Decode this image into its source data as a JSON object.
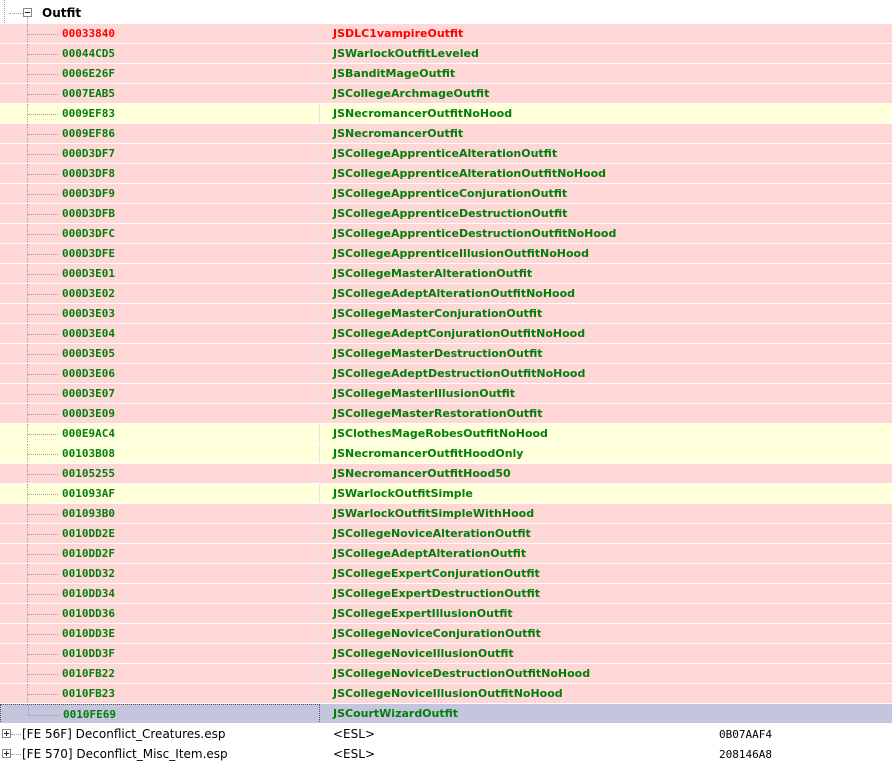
{
  "group": {
    "label": "Outfit",
    "expanded": true
  },
  "records": [
    {
      "formid": "00033840",
      "editor_id": "JSDLC1vampireOutfit",
      "style": "red",
      "text_color": "red"
    },
    {
      "formid": "00044CD5",
      "editor_id": "JSWarlockOutfitLeveled",
      "style": "red",
      "text_color": "green"
    },
    {
      "formid": "0006E26F",
      "editor_id": "JSBanditMageOutfit",
      "style": "red",
      "text_color": "green"
    },
    {
      "formid": "0007EAB5",
      "editor_id": "JSCollegeArchmageOutfit",
      "style": "red",
      "text_color": "green"
    },
    {
      "formid": "0009EF83",
      "editor_id": "JSNecromancerOutfitNoHood",
      "style": "yellow",
      "text_color": "green"
    },
    {
      "formid": "0009EF86",
      "editor_id": "JSNecromancerOutfit",
      "style": "red",
      "text_color": "green"
    },
    {
      "formid": "000D3DF7",
      "editor_id": "JSCollegeApprenticeAlterationOutfit",
      "style": "red",
      "text_color": "green"
    },
    {
      "formid": "000D3DF8",
      "editor_id": "JSCollegeApprenticeAlterationOutfitNoHood",
      "style": "red",
      "text_color": "green"
    },
    {
      "formid": "000D3DF9",
      "editor_id": "JSCollegeApprenticeConjurationOutfit",
      "style": "red",
      "text_color": "green"
    },
    {
      "formid": "000D3DFB",
      "editor_id": "JSCollegeApprenticeDestructionOutfit",
      "style": "red",
      "text_color": "green"
    },
    {
      "formid": "000D3DFC",
      "editor_id": "JSCollegeApprenticeDestructionOutfitNoHood",
      "style": "red",
      "text_color": "green"
    },
    {
      "formid": "000D3DFE",
      "editor_id": "JSCollegeApprenticeIllusionOutfitNoHood",
      "style": "red",
      "text_color": "green"
    },
    {
      "formid": "000D3E01",
      "editor_id": "JSCollegeMasterAlterationOutfit",
      "style": "red",
      "text_color": "green"
    },
    {
      "formid": "000D3E02",
      "editor_id": "JSCollegeAdeptAlterationOutfitNoHood",
      "style": "red",
      "text_color": "green"
    },
    {
      "formid": "000D3E03",
      "editor_id": "JSCollegeMasterConjurationOutfit",
      "style": "red",
      "text_color": "green"
    },
    {
      "formid": "000D3E04",
      "editor_id": "JSCollegeAdeptConjurationOutfitNoHood",
      "style": "red",
      "text_color": "green"
    },
    {
      "formid": "000D3E05",
      "editor_id": "JSCollegeMasterDestructionOutfit",
      "style": "red",
      "text_color": "green"
    },
    {
      "formid": "000D3E06",
      "editor_id": "JSCollegeAdeptDestructionOutfitNoHood",
      "style": "red",
      "text_color": "green"
    },
    {
      "formid": "000D3E07",
      "editor_id": "JSCollegeMasterIllusionOutfit",
      "style": "red",
      "text_color": "green"
    },
    {
      "formid": "000D3E09",
      "editor_id": "JSCollegeMasterRestorationOutfit",
      "style": "red",
      "text_color": "green"
    },
    {
      "formid": "000E9AC4",
      "editor_id": "JSClothesMageRobesOutfitNoHood",
      "style": "yellow",
      "text_color": "green"
    },
    {
      "formid": "00103B08",
      "editor_id": "JSNecromancerOutfitHoodOnly",
      "style": "yellow",
      "text_color": "green"
    },
    {
      "formid": "00105255",
      "editor_id": "JSNecromancerOutfitHood50",
      "style": "red",
      "text_color": "green"
    },
    {
      "formid": "001093AF",
      "editor_id": "JSWarlockOutfitSimple",
      "style": "yellow",
      "text_color": "green"
    },
    {
      "formid": "001093B0",
      "editor_id": "JSWarlockOutfitSimpleWithHood",
      "style": "red",
      "text_color": "green"
    },
    {
      "formid": "0010DD2E",
      "editor_id": "JSCollegeNoviceAlterationOutfit",
      "style": "red",
      "text_color": "green"
    },
    {
      "formid": "0010DD2F",
      "editor_id": "JSCollegeAdeptAlterationOutfit",
      "style": "red",
      "text_color": "green"
    },
    {
      "formid": "0010DD32",
      "editor_id": "JSCollegeExpertConjurationOutfit",
      "style": "red",
      "text_color": "green"
    },
    {
      "formid": "0010DD34",
      "editor_id": "JSCollegeExpertDestructionOutfit",
      "style": "red",
      "text_color": "green"
    },
    {
      "formid": "0010DD36",
      "editor_id": "JSCollegeExpertIllusionOutfit",
      "style": "red",
      "text_color": "green"
    },
    {
      "formid": "0010DD3E",
      "editor_id": "JSCollegeNoviceConjurationOutfit",
      "style": "red",
      "text_color": "green"
    },
    {
      "formid": "0010DD3F",
      "editor_id": "JSCollegeNoviceIllusionOutfit",
      "style": "red",
      "text_color": "green"
    },
    {
      "formid": "0010FB22",
      "editor_id": "JSCollegeNoviceDestructionOutfitNoHood",
      "style": "red",
      "text_color": "green"
    },
    {
      "formid": "0010FB23",
      "editor_id": "JSCollegeNoviceIllusionOutfitNoHood",
      "style": "red",
      "text_color": "green"
    },
    {
      "formid": "0010FE69",
      "editor_id": "JSCourtWizardOutfit",
      "style": "selected",
      "text_color": "green"
    }
  ],
  "plugins": [
    {
      "name": "[FE 56F] Deconflict_Creatures.esp",
      "flag": "<ESL>",
      "value": "0B07AAF4"
    },
    {
      "name": "[FE 570] Deconflict_Misc_Item.esp",
      "flag": "<ESL>",
      "value": "208146A8"
    }
  ],
  "colors": {
    "conflict_red_bg": "#ffd7d7",
    "conflict_yellow_bg": "#ffffd9",
    "selected_bg": "#c5c5dd",
    "text_green": "#00800a",
    "text_red": "#ff0000"
  }
}
